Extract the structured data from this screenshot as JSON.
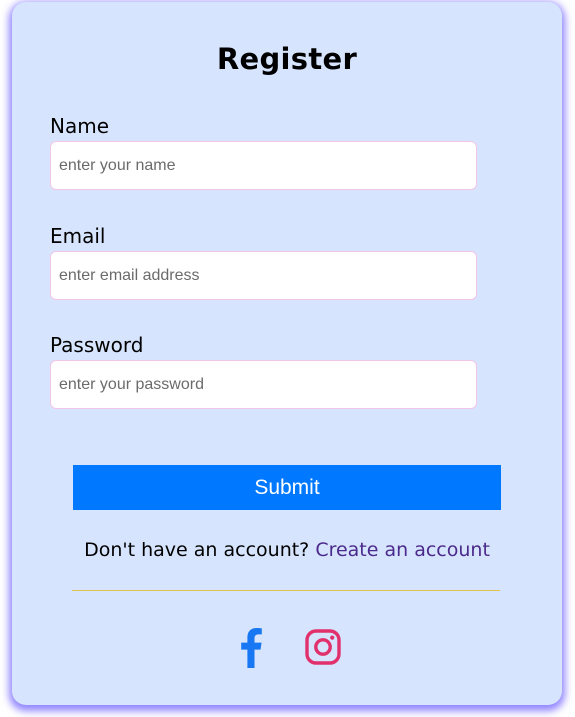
{
  "form": {
    "title": "Register",
    "fields": [
      {
        "label": "Name",
        "value": "",
        "placeholder": "enter your name"
      },
      {
        "label": "Email",
        "value": "",
        "placeholder": "enter email address"
      },
      {
        "label": "Password",
        "value": "",
        "placeholder": "enter your password"
      }
    ],
    "submit_label": "Submit"
  },
  "signup": {
    "prompt": "Don't have an account?",
    "link_label": "Create an account"
  },
  "social": {
    "icons": [
      {
        "name": "facebook-icon",
        "color": "#1877f2"
      },
      {
        "name": "instagram-icon",
        "color": "#e1306c"
      }
    ]
  },
  "colors": {
    "card_background": "#d6e4fd",
    "card_shadow": "#6c5cff",
    "submit_button": "#0078ff",
    "link": "#4b2a8c",
    "divider": "#e0c24a",
    "input_border": "#f2c6e6"
  }
}
